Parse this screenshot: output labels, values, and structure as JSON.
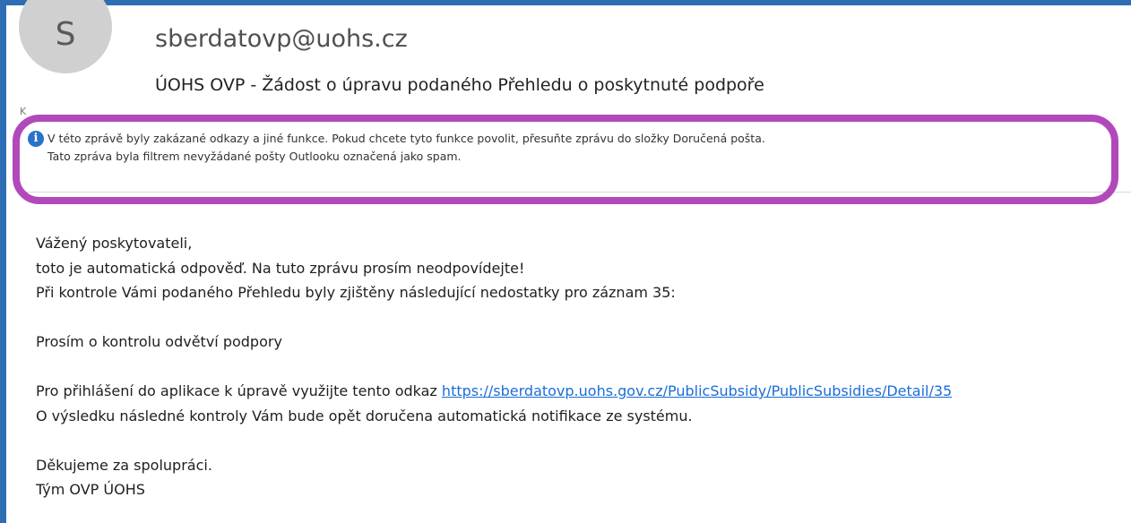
{
  "header": {
    "avatar_initial": "S",
    "sender": "sberdatovp@uohs.cz",
    "subject": "ÚOHS OVP - Žádost o úpravu podaného Přehledu o poskytnuté podpoře",
    "truncated_line": "K"
  },
  "info_bar": {
    "icon": "info-icon",
    "line1": "V této zprávě byly zakázané odkazy a jiné funkce. Pokud chcete tyto funkce povolit, přesuňte zprávu do složky Doručená pošta.",
    "line2": "Tato zpráva byla filtrem nevyžádané pošty Outlooku označená jako spam.",
    "highlight_color": "#b249bb"
  },
  "body": {
    "greeting": "Vážený poskytovateli,",
    "line_auto": "toto je automatická odpověď. Na tuto zprávu prosím neodpovídejte!",
    "line_check": "Při kontrole Vámi podaného Přehledu byly zjištěny následující nedostatky pro záznam 35:",
    "request": "Prosím o kontrolu odvětví podpory",
    "login_text": "Pro přihlášení do aplikace k úpravě využijte tento odkaz ",
    "link": "https://sberdatovp.uohs.gov.cz/PublicSubsidy/PublicSubsidies/Detail/35",
    "notify": "O výsledku následné kontroly Vám bude opět doručena automatická notifikace ze systému.",
    "thanks": "Děkujeme za spolupráci.",
    "signature": "Tým OVP ÚOHS"
  },
  "colors": {
    "frame": "#2e6db4",
    "link": "#1a6ed8",
    "info_icon": "#2873c8"
  }
}
